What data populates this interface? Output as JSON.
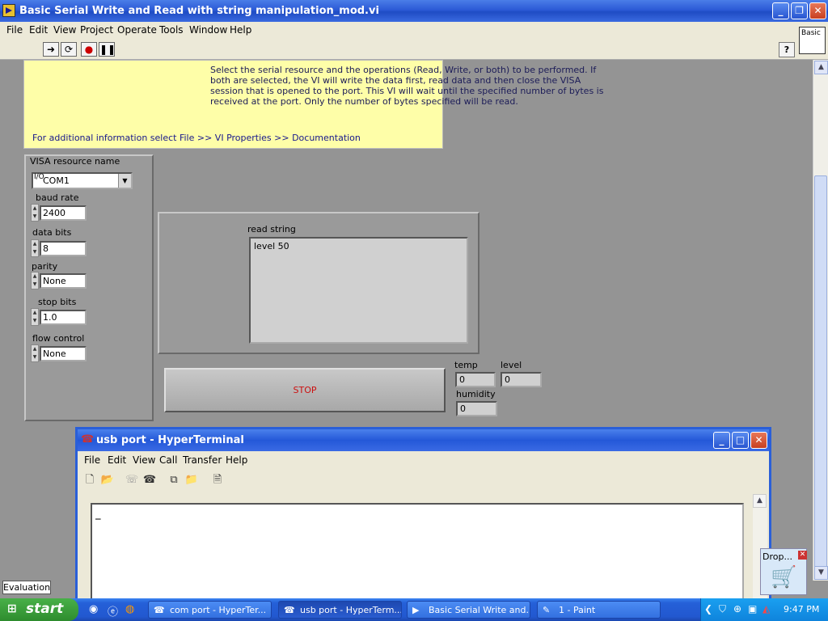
{
  "lv_window": {
    "title": "Basic Serial Write and Read with string manipulation_mod.vi",
    "menu": [
      "File",
      "Edit",
      "View",
      "Project",
      "Operate",
      "Tools",
      "Window",
      "Help"
    ],
    "palette_label": "Basic",
    "help_label": "?"
  },
  "note": {
    "description": "Select the serial resource and the operations (Read, Write, or both) to be performed.  If both are selected, the VI will write the data first, read data and then close the VISA session that is opened to the port.  This VI will wait until the specified number of bytes is received at the port. Only the number of bytes specified will be read.",
    "info": "For additional information select File >> VI Properties >> Documentation"
  },
  "controls": {
    "visa_label": "VISA resource name",
    "visa_value": "COM1",
    "visa_io": "I/O",
    "baud_label": "baud rate",
    "baud_value": "2400",
    "databits_label": "data bits",
    "databits_value": "8",
    "parity_label": "parity",
    "parity_value": "None",
    "stopbits_label": "stop bits",
    "stopbits_value": "1.0",
    "flow_label": "flow control",
    "flow_value": "None"
  },
  "read_string": {
    "label": "read string",
    "value": "level 50"
  },
  "stop_label": "STOP",
  "indicators": {
    "temp_label": "temp",
    "temp_value": "0",
    "level_label": "level",
    "level_value": "0",
    "humidity_label": "humidity",
    "humidity_value": "0"
  },
  "evaluation_label": "Evaluation",
  "hyperterminal": {
    "title": "usb port - HyperTerminal",
    "menu": [
      "File",
      "Edit",
      "View",
      "Call",
      "Transfer",
      "Help"
    ],
    "cursor": "_"
  },
  "drop_label": "Drop...",
  "taskbar": {
    "start_label": "start",
    "tasks": [
      "com port - HyperTer...",
      "usb port - HyperTerm...",
      "Basic Serial Write and...",
      "1 - Paint"
    ],
    "clock": "9:47 PM"
  },
  "colors": {
    "note_bg": "#fefea8",
    "panel_bg": "#949494",
    "stop_text": "#cc1010"
  }
}
